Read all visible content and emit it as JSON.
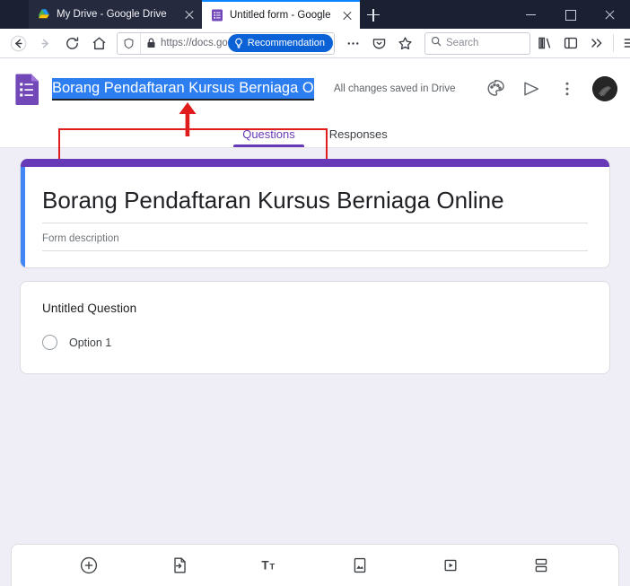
{
  "browser": {
    "tabs": [
      {
        "title": "My Drive - Google Drive",
        "favicon": "google-drive-icon",
        "active": false
      },
      {
        "title": "Untitled form - Google Forms",
        "favicon": "google-forms-icon",
        "active": true
      }
    ],
    "new_tab_label": "+",
    "window_controls": [
      "minimize",
      "maximize",
      "close"
    ],
    "nav": {
      "back": "back-arrow-icon",
      "forward": "forward-arrow-icon",
      "reload": "reload-icon",
      "home": "home-icon"
    },
    "url": {
      "text": "https://docs.go",
      "shield_icon": "tracking-protection-shield-icon",
      "lock_icon": "padlock-icon",
      "recommendation_pill": "Recommendation"
    },
    "search": {
      "placeholder": "Search",
      "icon": "search-icon"
    },
    "toolbar_right": [
      "library-icon",
      "sidebar-icon",
      "overflow-chevrons-icon",
      "hamburger-menu-icon"
    ]
  },
  "forms": {
    "logo": "google-forms-logo",
    "title_value": "Borang Pendaftaran Kursus Berniaga Online",
    "save_status": "All changes saved in Drive",
    "actions": [
      {
        "name": "theme-palette-icon",
        "label": "Customize theme"
      },
      {
        "name": "send-icon",
        "label": "Send"
      },
      {
        "name": "more-options-icon",
        "label": "More options"
      }
    ],
    "avatar": "user-avatar",
    "tabs": [
      {
        "label": "Questions",
        "active": true
      },
      {
        "label": "Responses",
        "active": false
      }
    ],
    "form_card": {
      "title": "Borang Pendaftaran Kursus Berniaga Online",
      "description_placeholder": "Form description"
    },
    "question_card": {
      "title": "Untitled Question",
      "options": [
        {
          "label": "Option 1"
        }
      ]
    },
    "bottom_toolbar": [
      {
        "name": "add-question-icon",
        "label": "Add question"
      },
      {
        "name": "import-questions-icon",
        "label": "Import questions"
      },
      {
        "name": "add-title-description-icon",
        "label": "Add title and description"
      },
      {
        "name": "add-image-icon",
        "label": "Add image"
      },
      {
        "name": "add-video-icon",
        "label": "Add video"
      },
      {
        "name": "add-section-icon",
        "label": "Add section"
      }
    ]
  },
  "annotation": {
    "box_color": "#e01b1b",
    "arrow_color": "#e01b1b",
    "target": "form-title-input"
  },
  "colors": {
    "forms_purple": "#673ab7",
    "focus_blue": "#4285f4",
    "selection_blue": "#2d7ff1",
    "page_background": "#efedf6",
    "chrome_dark": "#1c2033",
    "recommendation_blue": "#0b62d6"
  }
}
